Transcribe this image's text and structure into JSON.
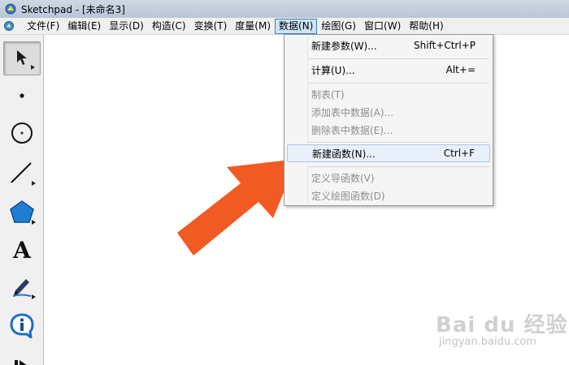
{
  "window": {
    "title": "Sketchpad  - [未命名3]"
  },
  "menubar": {
    "items": [
      {
        "label": "文件(F)"
      },
      {
        "label": "编辑(E)"
      },
      {
        "label": "显示(D)"
      },
      {
        "label": "构造(C)"
      },
      {
        "label": "变换(T)"
      },
      {
        "label": "度量(M)"
      },
      {
        "label": "数据(N)",
        "active": true
      },
      {
        "label": "绘图(G)"
      },
      {
        "label": "窗口(W)"
      },
      {
        "label": "帮助(H)"
      }
    ]
  },
  "toolbox": {
    "tools": [
      {
        "name": "arrow-select-tool",
        "icon": "pointer-arrow-icon",
        "selected": true
      },
      {
        "name": "point-tool",
        "icon": "point-icon"
      },
      {
        "name": "compass-tool",
        "icon": "circle-icon"
      },
      {
        "name": "straightedge-tool",
        "icon": "segment-icon"
      },
      {
        "name": "polygon-tool",
        "icon": "pentagon-icon"
      },
      {
        "name": "text-tool",
        "icon": "text-a-icon",
        "glyph": "A"
      },
      {
        "name": "marker-tool",
        "icon": "marker-pen-icon"
      },
      {
        "name": "information-tool",
        "icon": "info-icon"
      },
      {
        "name": "custom-tool",
        "icon": "custom-tool-icon"
      }
    ]
  },
  "data_menu": {
    "groups": [
      [
        {
          "label": "新建参数(W)...",
          "shortcut": "Shift+Ctrl+P",
          "enabled": true
        }
      ],
      [
        {
          "label": "计算(U)...",
          "shortcut": "Alt+=",
          "enabled": true
        }
      ],
      [
        {
          "label": "制表(T)",
          "shortcut": "",
          "enabled": false
        },
        {
          "label": "添加表中数据(A)...",
          "shortcut": "",
          "enabled": false
        },
        {
          "label": "删除表中数据(E)...",
          "shortcut": "",
          "enabled": false
        }
      ],
      [
        {
          "label": "新建函数(N)...",
          "shortcut": "Ctrl+F",
          "enabled": true,
          "highlighted": true
        }
      ],
      [
        {
          "label": "定义导函数(V)",
          "shortcut": "",
          "enabled": false
        },
        {
          "label": "定义绘图函数(D)",
          "shortcut": "",
          "enabled": false
        }
      ]
    ]
  },
  "annotation": {
    "arrow_color": "#f15a22"
  },
  "watermark": {
    "main": "Bai du 经验",
    "sub": "jingyan.baidu.com"
  }
}
